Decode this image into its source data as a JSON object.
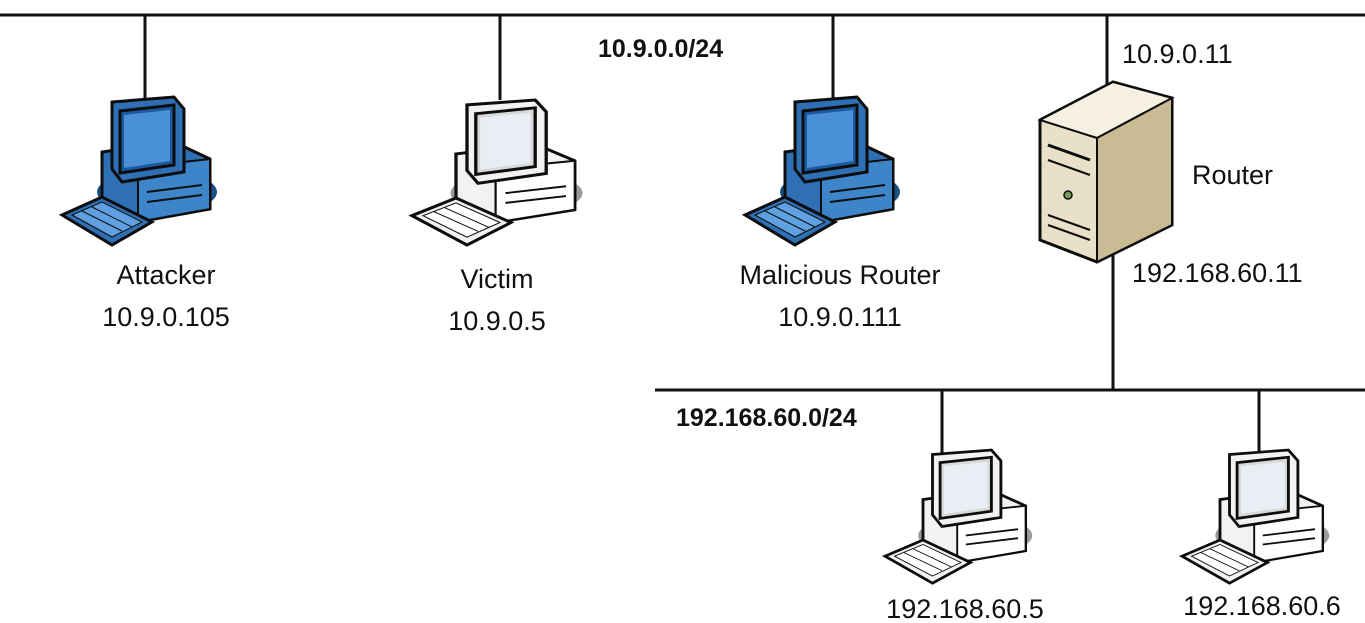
{
  "networks": {
    "top": {
      "label": "10.9.0.0/24"
    },
    "bottom": {
      "label": "192.168.60.0/24"
    }
  },
  "hosts": {
    "attacker": {
      "name": "Attacker",
      "ip": "10.9.0.105",
      "color": "blue"
    },
    "victim": {
      "name": "Victim",
      "ip": "10.9.0.5",
      "color": "white"
    },
    "malicious_router": {
      "name": "Malicious Router",
      "ip": "10.9.0.111",
      "color": "blue"
    },
    "host_a": {
      "ip": "192.168.60.5",
      "color": "white"
    },
    "host_b": {
      "ip": "192.168.60.6",
      "color": "white"
    }
  },
  "router": {
    "name": "Router",
    "ip_top": "10.9.0.11",
    "ip_bottom": "192.168.60.11"
  },
  "colors": {
    "blue_body": "#2f6fb3",
    "blue_dark": "#174a7e",
    "white_body": "#f2f2f2",
    "server_body": "#e8e0c8"
  }
}
